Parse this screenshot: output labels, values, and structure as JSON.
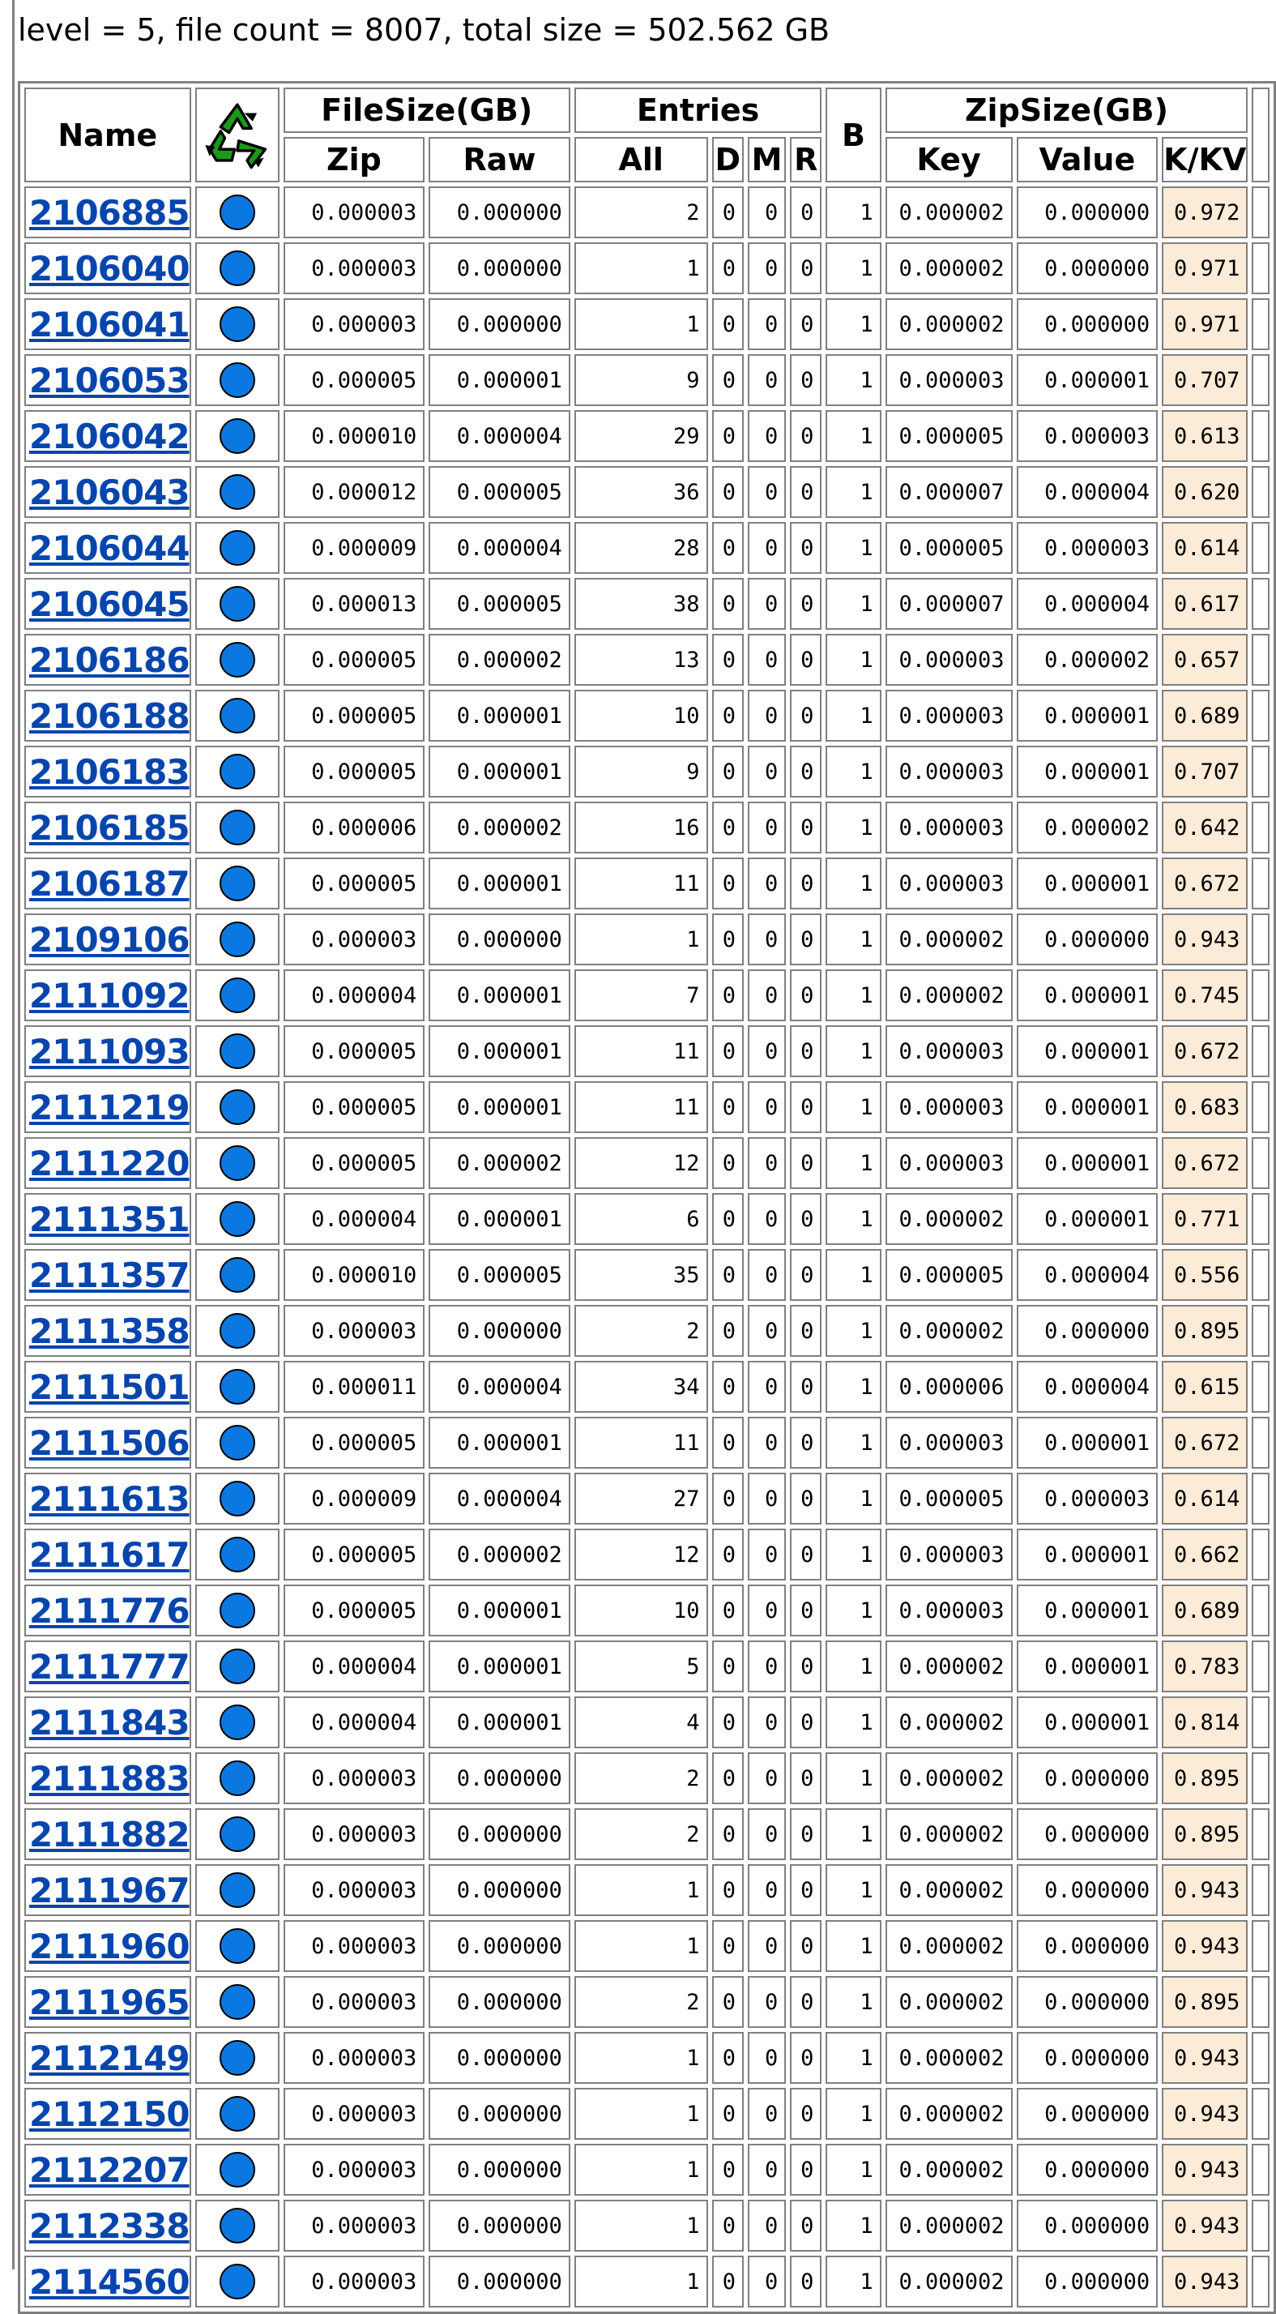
{
  "summary": "level = 5, file count = 8007, total size = 502.562 GB",
  "headers": {
    "name": "Name",
    "recycle_icon": "recycle-icon",
    "filesize": "FileSize(GB)",
    "zip": "Zip",
    "raw": "Raw",
    "entries": "Entries",
    "all": "All",
    "d": "D",
    "m": "M",
    "r": "R",
    "b": "B",
    "zipsize": "ZipSize(GB)",
    "key": "Key",
    "value": "Value",
    "kkv": "K/KV"
  },
  "colors": {
    "link": "#0645ad",
    "dot": "#0a78e0",
    "kkv_bg": "#fcebd6",
    "border": "#808080"
  },
  "rows": [
    {
      "name": "2106885",
      "zip": "0.000003",
      "raw": "0.000000",
      "all": "2",
      "d": "0",
      "m": "0",
      "r": "0",
      "b": "1",
      "key": "0.000002",
      "value": "0.000000",
      "kkv": "0.972"
    },
    {
      "name": "2106040",
      "zip": "0.000003",
      "raw": "0.000000",
      "all": "1",
      "d": "0",
      "m": "0",
      "r": "0",
      "b": "1",
      "key": "0.000002",
      "value": "0.000000",
      "kkv": "0.971"
    },
    {
      "name": "2106041",
      "zip": "0.000003",
      "raw": "0.000000",
      "all": "1",
      "d": "0",
      "m": "0",
      "r": "0",
      "b": "1",
      "key": "0.000002",
      "value": "0.000000",
      "kkv": "0.971"
    },
    {
      "name": "2106053",
      "zip": "0.000005",
      "raw": "0.000001",
      "all": "9",
      "d": "0",
      "m": "0",
      "r": "0",
      "b": "1",
      "key": "0.000003",
      "value": "0.000001",
      "kkv": "0.707"
    },
    {
      "name": "2106042",
      "zip": "0.000010",
      "raw": "0.000004",
      "all": "29",
      "d": "0",
      "m": "0",
      "r": "0",
      "b": "1",
      "key": "0.000005",
      "value": "0.000003",
      "kkv": "0.613"
    },
    {
      "name": "2106043",
      "zip": "0.000012",
      "raw": "0.000005",
      "all": "36",
      "d": "0",
      "m": "0",
      "r": "0",
      "b": "1",
      "key": "0.000007",
      "value": "0.000004",
      "kkv": "0.620"
    },
    {
      "name": "2106044",
      "zip": "0.000009",
      "raw": "0.000004",
      "all": "28",
      "d": "0",
      "m": "0",
      "r": "0",
      "b": "1",
      "key": "0.000005",
      "value": "0.000003",
      "kkv": "0.614"
    },
    {
      "name": "2106045",
      "zip": "0.000013",
      "raw": "0.000005",
      "all": "38",
      "d": "0",
      "m": "0",
      "r": "0",
      "b": "1",
      "key": "0.000007",
      "value": "0.000004",
      "kkv": "0.617"
    },
    {
      "name": "2106186",
      "zip": "0.000005",
      "raw": "0.000002",
      "all": "13",
      "d": "0",
      "m": "0",
      "r": "0",
      "b": "1",
      "key": "0.000003",
      "value": "0.000002",
      "kkv": "0.657"
    },
    {
      "name": "2106188",
      "zip": "0.000005",
      "raw": "0.000001",
      "all": "10",
      "d": "0",
      "m": "0",
      "r": "0",
      "b": "1",
      "key": "0.000003",
      "value": "0.000001",
      "kkv": "0.689"
    },
    {
      "name": "2106183",
      "zip": "0.000005",
      "raw": "0.000001",
      "all": "9",
      "d": "0",
      "m": "0",
      "r": "0",
      "b": "1",
      "key": "0.000003",
      "value": "0.000001",
      "kkv": "0.707"
    },
    {
      "name": "2106185",
      "zip": "0.000006",
      "raw": "0.000002",
      "all": "16",
      "d": "0",
      "m": "0",
      "r": "0",
      "b": "1",
      "key": "0.000003",
      "value": "0.000002",
      "kkv": "0.642"
    },
    {
      "name": "2106187",
      "zip": "0.000005",
      "raw": "0.000001",
      "all": "11",
      "d": "0",
      "m": "0",
      "r": "0",
      "b": "1",
      "key": "0.000003",
      "value": "0.000001",
      "kkv": "0.672"
    },
    {
      "name": "2109106",
      "zip": "0.000003",
      "raw": "0.000000",
      "all": "1",
      "d": "0",
      "m": "0",
      "r": "0",
      "b": "1",
      "key": "0.000002",
      "value": "0.000000",
      "kkv": "0.943"
    },
    {
      "name": "2111092",
      "zip": "0.000004",
      "raw": "0.000001",
      "all": "7",
      "d": "0",
      "m": "0",
      "r": "0",
      "b": "1",
      "key": "0.000002",
      "value": "0.000001",
      "kkv": "0.745"
    },
    {
      "name": "2111093",
      "zip": "0.000005",
      "raw": "0.000001",
      "all": "11",
      "d": "0",
      "m": "0",
      "r": "0",
      "b": "1",
      "key": "0.000003",
      "value": "0.000001",
      "kkv": "0.672"
    },
    {
      "name": "2111219",
      "zip": "0.000005",
      "raw": "0.000001",
      "all": "11",
      "d": "0",
      "m": "0",
      "r": "0",
      "b": "1",
      "key": "0.000003",
      "value": "0.000001",
      "kkv": "0.683"
    },
    {
      "name": "2111220",
      "zip": "0.000005",
      "raw": "0.000002",
      "all": "12",
      "d": "0",
      "m": "0",
      "r": "0",
      "b": "1",
      "key": "0.000003",
      "value": "0.000001",
      "kkv": "0.672"
    },
    {
      "name": "2111351",
      "zip": "0.000004",
      "raw": "0.000001",
      "all": "6",
      "d": "0",
      "m": "0",
      "r": "0",
      "b": "1",
      "key": "0.000002",
      "value": "0.000001",
      "kkv": "0.771"
    },
    {
      "name": "2111357",
      "zip": "0.000010",
      "raw": "0.000005",
      "all": "35",
      "d": "0",
      "m": "0",
      "r": "0",
      "b": "1",
      "key": "0.000005",
      "value": "0.000004",
      "kkv": "0.556"
    },
    {
      "name": "2111358",
      "zip": "0.000003",
      "raw": "0.000000",
      "all": "2",
      "d": "0",
      "m": "0",
      "r": "0",
      "b": "1",
      "key": "0.000002",
      "value": "0.000000",
      "kkv": "0.895"
    },
    {
      "name": "2111501",
      "zip": "0.000011",
      "raw": "0.000004",
      "all": "34",
      "d": "0",
      "m": "0",
      "r": "0",
      "b": "1",
      "key": "0.000006",
      "value": "0.000004",
      "kkv": "0.615"
    },
    {
      "name": "2111506",
      "zip": "0.000005",
      "raw": "0.000001",
      "all": "11",
      "d": "0",
      "m": "0",
      "r": "0",
      "b": "1",
      "key": "0.000003",
      "value": "0.000001",
      "kkv": "0.672"
    },
    {
      "name": "2111613",
      "zip": "0.000009",
      "raw": "0.000004",
      "all": "27",
      "d": "0",
      "m": "0",
      "r": "0",
      "b": "1",
      "key": "0.000005",
      "value": "0.000003",
      "kkv": "0.614"
    },
    {
      "name": "2111617",
      "zip": "0.000005",
      "raw": "0.000002",
      "all": "12",
      "d": "0",
      "m": "0",
      "r": "0",
      "b": "1",
      "key": "0.000003",
      "value": "0.000001",
      "kkv": "0.662"
    },
    {
      "name": "2111776",
      "zip": "0.000005",
      "raw": "0.000001",
      "all": "10",
      "d": "0",
      "m": "0",
      "r": "0",
      "b": "1",
      "key": "0.000003",
      "value": "0.000001",
      "kkv": "0.689"
    },
    {
      "name": "2111777",
      "zip": "0.000004",
      "raw": "0.000001",
      "all": "5",
      "d": "0",
      "m": "0",
      "r": "0",
      "b": "1",
      "key": "0.000002",
      "value": "0.000001",
      "kkv": "0.783"
    },
    {
      "name": "2111843",
      "zip": "0.000004",
      "raw": "0.000001",
      "all": "4",
      "d": "0",
      "m": "0",
      "r": "0",
      "b": "1",
      "key": "0.000002",
      "value": "0.000001",
      "kkv": "0.814"
    },
    {
      "name": "2111883",
      "zip": "0.000003",
      "raw": "0.000000",
      "all": "2",
      "d": "0",
      "m": "0",
      "r": "0",
      "b": "1",
      "key": "0.000002",
      "value": "0.000000",
      "kkv": "0.895"
    },
    {
      "name": "2111882",
      "zip": "0.000003",
      "raw": "0.000000",
      "all": "2",
      "d": "0",
      "m": "0",
      "r": "0",
      "b": "1",
      "key": "0.000002",
      "value": "0.000000",
      "kkv": "0.895"
    },
    {
      "name": "2111967",
      "zip": "0.000003",
      "raw": "0.000000",
      "all": "1",
      "d": "0",
      "m": "0",
      "r": "0",
      "b": "1",
      "key": "0.000002",
      "value": "0.000000",
      "kkv": "0.943"
    },
    {
      "name": "2111960",
      "zip": "0.000003",
      "raw": "0.000000",
      "all": "1",
      "d": "0",
      "m": "0",
      "r": "0",
      "b": "1",
      "key": "0.000002",
      "value": "0.000000",
      "kkv": "0.943"
    },
    {
      "name": "2111965",
      "zip": "0.000003",
      "raw": "0.000000",
      "all": "2",
      "d": "0",
      "m": "0",
      "r": "0",
      "b": "1",
      "key": "0.000002",
      "value": "0.000000",
      "kkv": "0.895"
    },
    {
      "name": "2112149",
      "zip": "0.000003",
      "raw": "0.000000",
      "all": "1",
      "d": "0",
      "m": "0",
      "r": "0",
      "b": "1",
      "key": "0.000002",
      "value": "0.000000",
      "kkv": "0.943"
    },
    {
      "name": "2112150",
      "zip": "0.000003",
      "raw": "0.000000",
      "all": "1",
      "d": "0",
      "m": "0",
      "r": "0",
      "b": "1",
      "key": "0.000002",
      "value": "0.000000",
      "kkv": "0.943"
    },
    {
      "name": "2112207",
      "zip": "0.000003",
      "raw": "0.000000",
      "all": "1",
      "d": "0",
      "m": "0",
      "r": "0",
      "b": "1",
      "key": "0.000002",
      "value": "0.000000",
      "kkv": "0.943"
    },
    {
      "name": "2112338",
      "zip": "0.000003",
      "raw": "0.000000",
      "all": "1",
      "d": "0",
      "m": "0",
      "r": "0",
      "b": "1",
      "key": "0.000002",
      "value": "0.000000",
      "kkv": "0.943"
    },
    {
      "name": "2114560",
      "zip": "0.000003",
      "raw": "0.000000",
      "all": "1",
      "d": "0",
      "m": "0",
      "r": "0",
      "b": "1",
      "key": "0.000002",
      "value": "0.000000",
      "kkv": "0.943"
    }
  ]
}
